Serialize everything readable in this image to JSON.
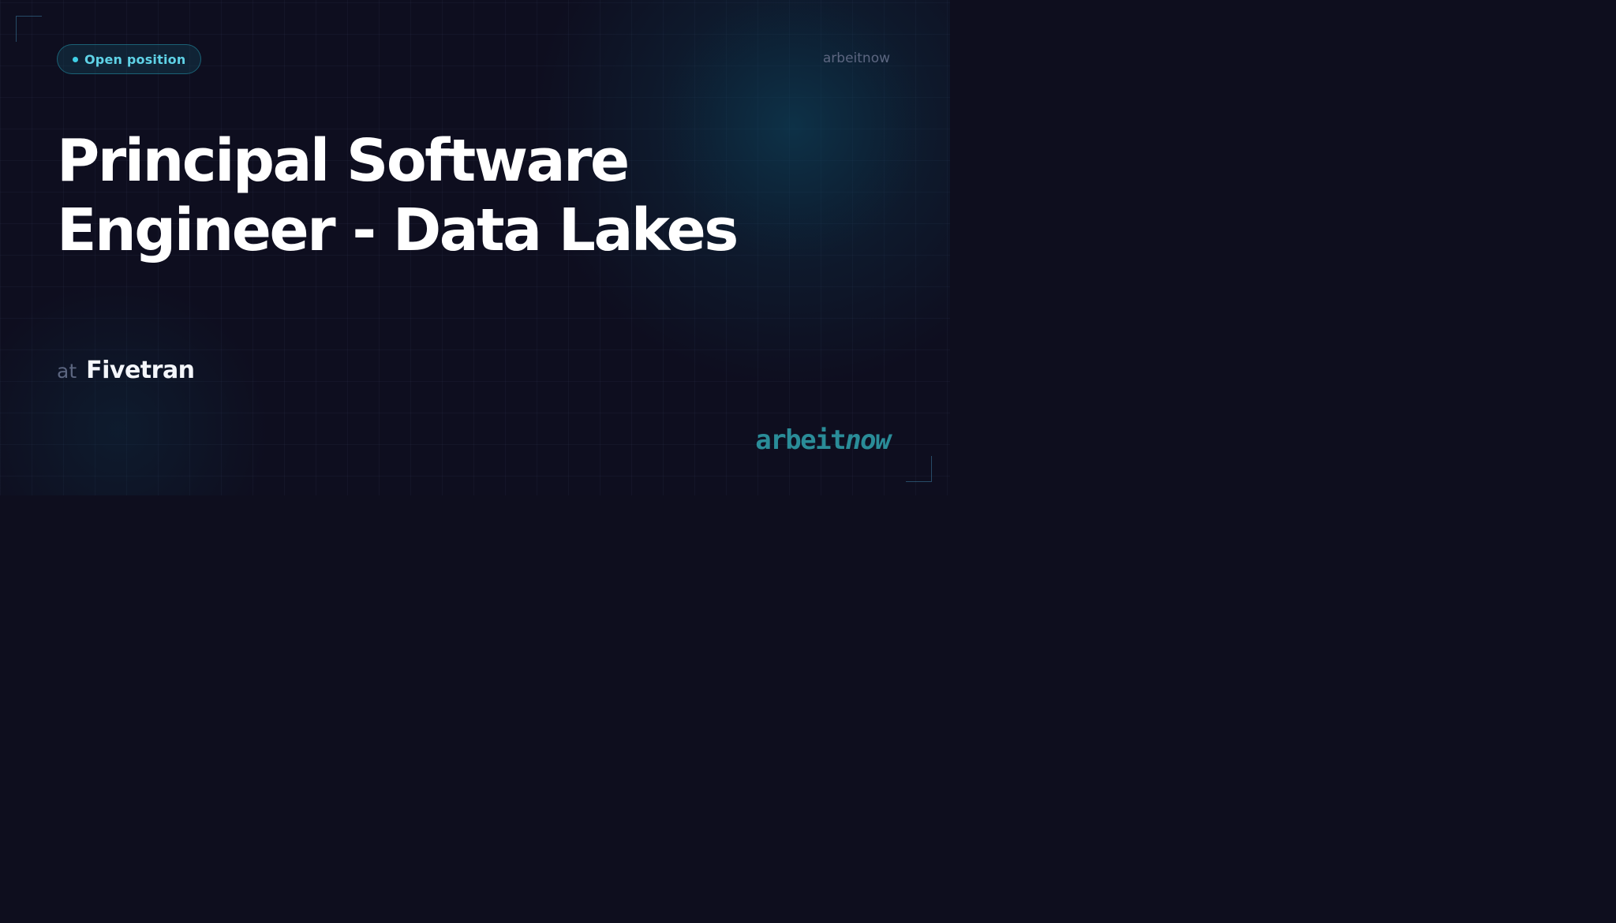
{
  "badge": {
    "label": "Open position"
  },
  "brand": {
    "top_text": "arbeitnow",
    "logo_part_1": "arbeit",
    "logo_part_2": "now"
  },
  "job": {
    "title": "Principal Software Engineer - Data Lakes",
    "at_label": "at",
    "company": "Fivetran"
  },
  "colors": {
    "background": "#0e0e1e",
    "accent": "#3fd0e6",
    "logo": "#2a8c98",
    "muted_text": "#5c6680",
    "title_text": "#ffffff"
  }
}
